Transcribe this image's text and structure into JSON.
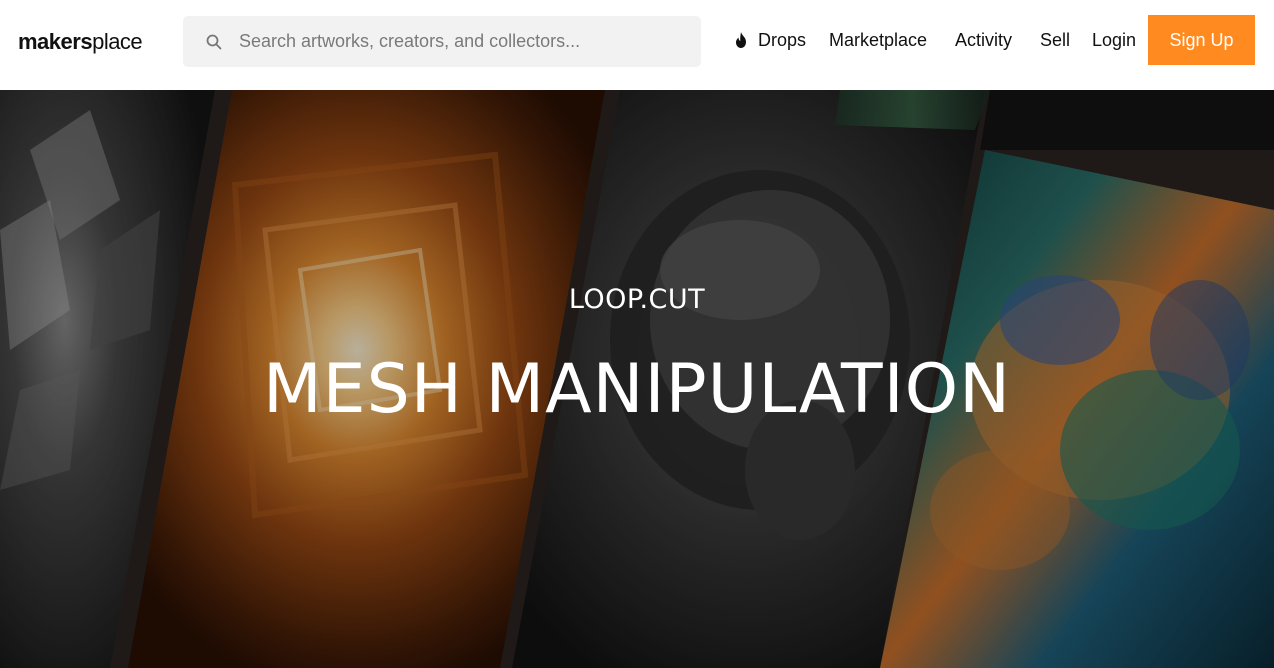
{
  "header": {
    "logo": {
      "bold": "makers",
      "light": "place"
    },
    "search": {
      "placeholder": "Search artworks, creators, and collectors..."
    },
    "nav": {
      "drops": "Drops",
      "marketplace": "Marketplace",
      "activity": "Activity",
      "sell": "Sell",
      "login": "Login"
    },
    "signup": "Sign Up"
  },
  "hero": {
    "subtitle": "LOOP.CUT",
    "title": "MESH MANIPULATION"
  },
  "colors": {
    "accent": "#ff8a1f",
    "search_bg": "#f2f2f2"
  },
  "icons": {
    "search": "search-icon",
    "drops": "flame-icon"
  }
}
